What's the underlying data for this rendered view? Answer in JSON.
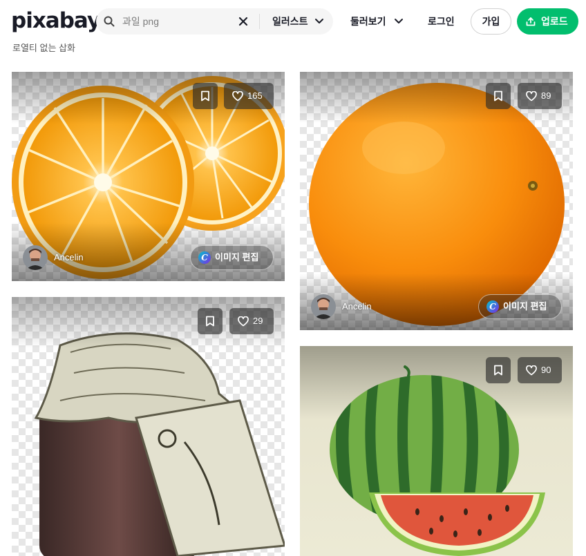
{
  "header": {
    "logo": "pixabay",
    "search_value": "과일 png",
    "search_type": "일러스트",
    "explore": "둘러보기",
    "login": "로그인",
    "join": "가입",
    "upload": "업로드"
  },
  "subtitle": "로열티 없는 삽화",
  "cards": [
    {
      "likes": "165",
      "author": "Ancelin",
      "edit_label": "이미지 편집"
    },
    {
      "likes": "89",
      "author": "Ancelin",
      "edit_label": "이미지 편집"
    },
    {
      "likes": "29"
    },
    {
      "likes": "90"
    }
  ],
  "colors": {
    "accent": "#02be6e",
    "text": "#191b26"
  }
}
